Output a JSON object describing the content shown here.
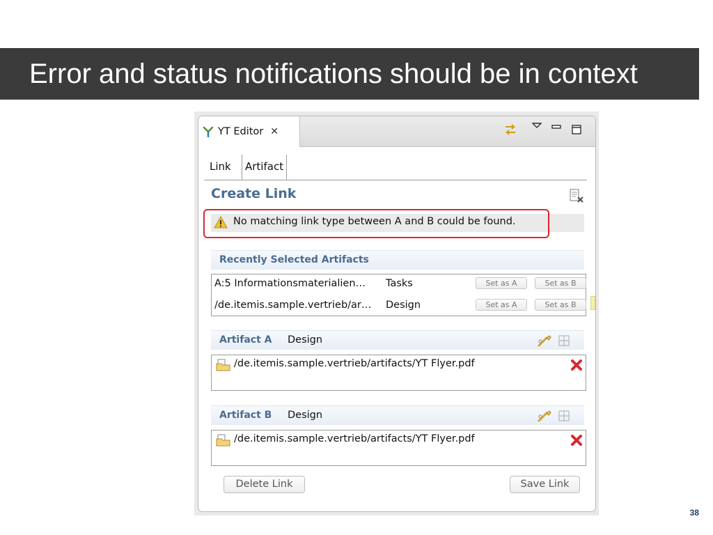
{
  "slide": {
    "title": "Error and status notifications should be in context",
    "page_number": "38"
  },
  "editor": {
    "tab_title": "YT Editor",
    "tab_close_glyph": "✕",
    "subtabs": [
      {
        "label": "Link"
      },
      {
        "label": "Artifact"
      }
    ],
    "form_title": "Create Link",
    "message": "No matching link type between A and B could be found.",
    "recent": {
      "title": "Recently Selected Artifacts",
      "rows": [
        {
          "path": "A:5 Informationsmaterialien…",
          "type": "Tasks",
          "set_a": "Set as A",
          "set_b": "Set as B"
        },
        {
          "path": "/de.itemis.sample.vertrieb/ar…",
          "type": "Design",
          "set_a": "Set as A",
          "set_b": "Set as B"
        }
      ]
    },
    "artifact_a": {
      "label": "Artifact A",
      "type": "Design",
      "file": "/de.itemis.sample.vertrieb/artifacts/YT Flyer.pdf"
    },
    "artifact_b": {
      "label": "Artifact B",
      "type": "Design",
      "file": "/de.itemis.sample.vertrieb/artifacts/YT Flyer.pdf"
    },
    "buttons": {
      "delete": "Delete Link",
      "save": "Save Link"
    }
  },
  "colors": {
    "title_bar": "#3b3b3b",
    "section_header_text": "#4a6c93",
    "highlight": "#e0252c",
    "page_number": "#1f3f6b"
  }
}
